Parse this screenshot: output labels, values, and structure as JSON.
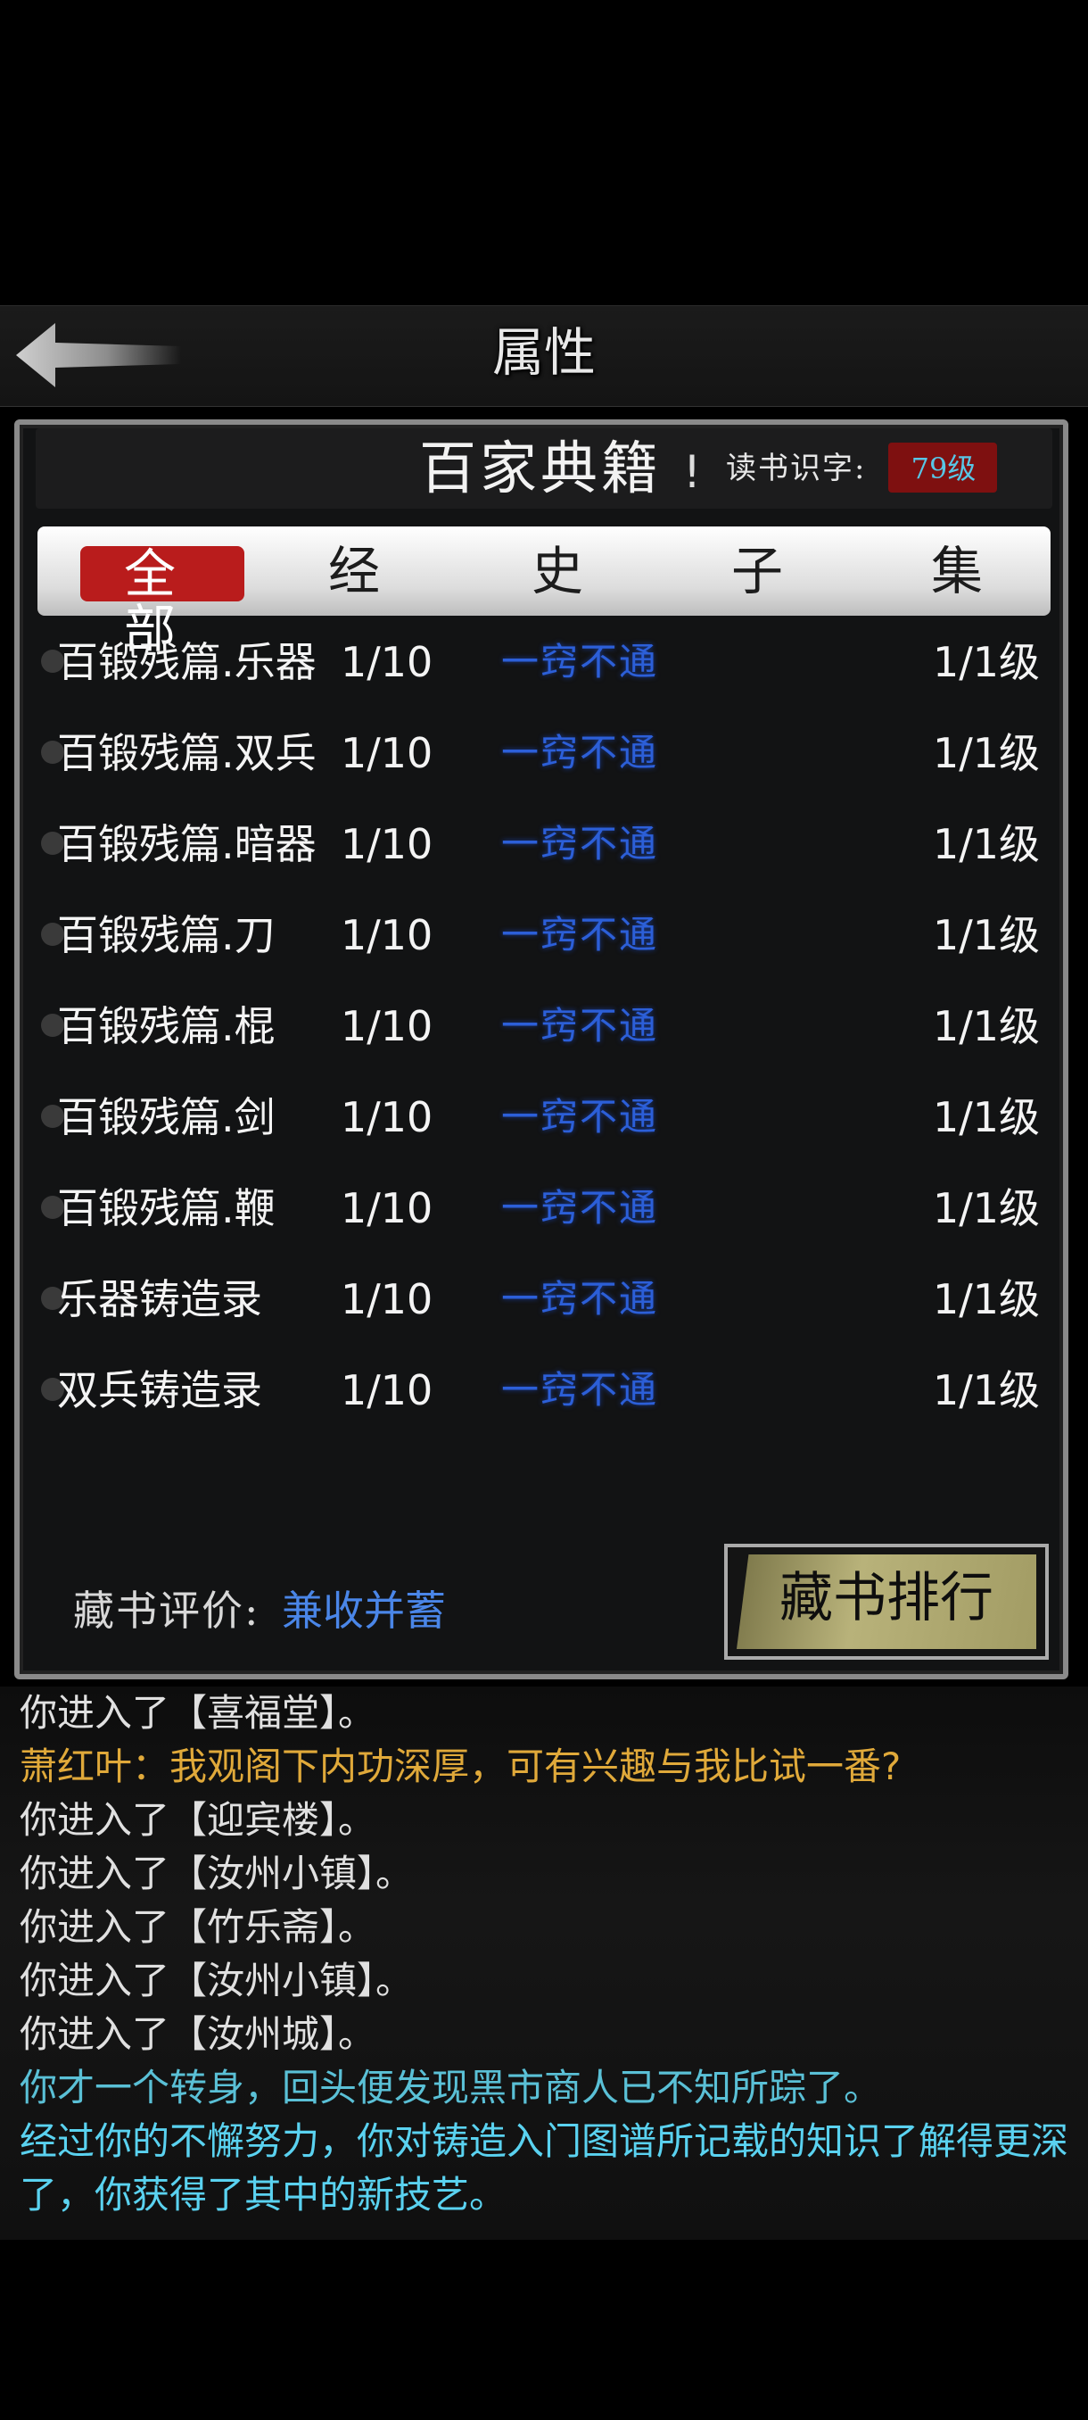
{
  "header": {
    "title": "属性",
    "back_icon": "arrow-left-icon"
  },
  "panel": {
    "subheader": {
      "title": "百家典籍",
      "exclaim": "!",
      "reading_label": "读书识字:",
      "reading_level": "79级"
    },
    "tabs": [
      {
        "label": "全部",
        "active": true
      },
      {
        "label": "经",
        "active": false
      },
      {
        "label": "史",
        "active": false
      },
      {
        "label": "子",
        "active": false
      },
      {
        "label": "集",
        "active": false
      }
    ],
    "books": [
      {
        "name": "百锻残篇.乐器",
        "progress": "1/10",
        "rank": "一窍不通",
        "level": "1/1级"
      },
      {
        "name": "百锻残篇.双兵",
        "progress": "1/10",
        "rank": "一窍不通",
        "level": "1/1级"
      },
      {
        "name": "百锻残篇.暗器",
        "progress": "1/10",
        "rank": "一窍不通",
        "level": "1/1级"
      },
      {
        "name": "百锻残篇.刀",
        "progress": "1/10",
        "rank": "一窍不通",
        "level": "1/1级"
      },
      {
        "name": "百锻残篇.棍",
        "progress": "1/10",
        "rank": "一窍不通",
        "level": "1/1级"
      },
      {
        "name": "百锻残篇.剑",
        "progress": "1/10",
        "rank": "一窍不通",
        "level": "1/1级"
      },
      {
        "name": "百锻残篇.鞭",
        "progress": "1/10",
        "rank": "一窍不通",
        "level": "1/1级"
      },
      {
        "name": "乐器铸造录",
        "progress": "1/10",
        "rank": "一窍不通",
        "level": "1/1级"
      },
      {
        "name": "双兵铸造录",
        "progress": "1/10",
        "rank": "一窍不通",
        "level": "1/1级"
      }
    ],
    "collection_label": "藏书评价:",
    "collection_value": "兼收并蓄",
    "rank_button": "藏书排行"
  },
  "logs": [
    {
      "text": "你进入了【喜福堂】。",
      "color": "#e0e0e0"
    },
    {
      "text": "萧红叶：我观阁下内功深厚，可有兴趣与我比试一番?",
      "color": "#e0a93a"
    },
    {
      "text": "你进入了【迎宾楼】。",
      "color": "#e0e0e0"
    },
    {
      "text": "你进入了【汝州小镇】。",
      "color": "#e0e0e0"
    },
    {
      "text": "你进入了【竹乐斋】。",
      "color": "#e0e0e0"
    },
    {
      "text": "你进入了【汝州小镇】。",
      "color": "#e0e0e0"
    },
    {
      "text": "你进入了【汝州城】。",
      "color": "#e0e0e0"
    },
    {
      "text": "你才一个转身，回头便发现黑市商人已不知所踪了。",
      "color": "#5ac0d6"
    },
    {
      "text": "经过你的不懈努力，你对铸造入门图谱所记载的知识了解得更深了，你获得了其中的新技艺。",
      "color": "#5ad2f0"
    }
  ]
}
